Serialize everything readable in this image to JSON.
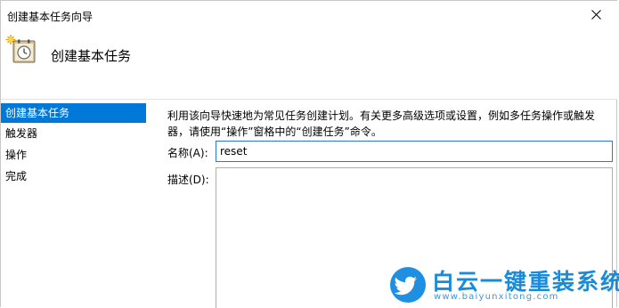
{
  "window": {
    "title": "创建基本任务向导"
  },
  "header": {
    "title": "创建基本任务"
  },
  "sidebar": {
    "items": [
      {
        "label": "创建基本任务",
        "active": true
      },
      {
        "label": "触发器",
        "active": false
      },
      {
        "label": "操作",
        "active": false
      },
      {
        "label": "完成",
        "active": false
      }
    ]
  },
  "main": {
    "description_line1": "利用该向导快速地为常见任务创建计划。有关更多高级选项或设置，例如多任务操作或触发",
    "description_line2": "器，请使用“操作”窗格中的“创建任务”命令。",
    "name_label": "名称(A):",
    "name_value": "reset",
    "desc_label": "描述(D):",
    "desc_value": ""
  },
  "watermark": {
    "title": "白云一键重装系统",
    "url": "www.baiyunxitong.com"
  },
  "colors": {
    "accent": "#0078d7",
    "watermark": "#1a8bd9"
  }
}
